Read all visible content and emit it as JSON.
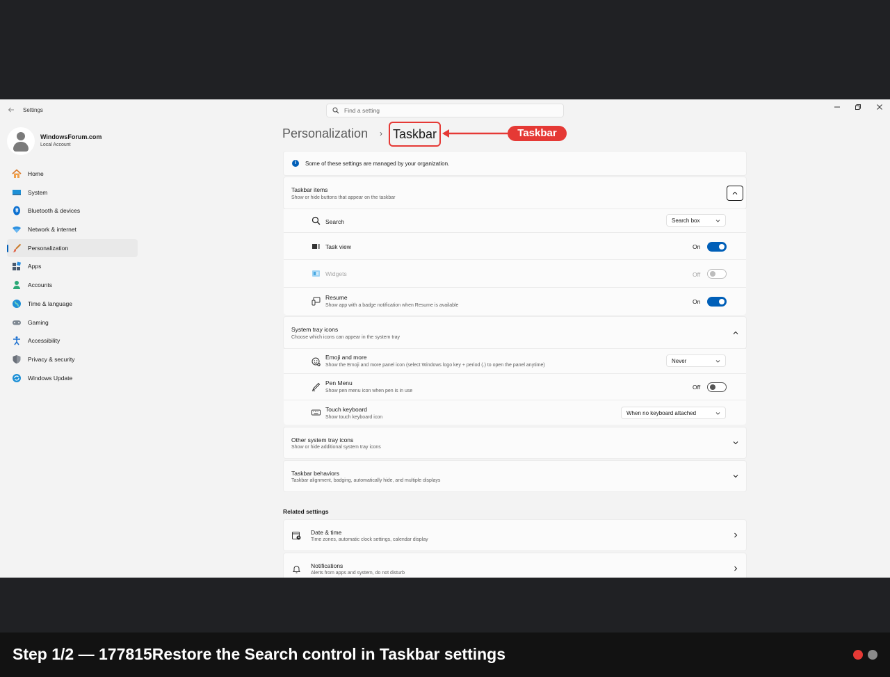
{
  "window": {
    "app_title": "Settings",
    "search_placeholder": "Find a setting"
  },
  "profile": {
    "name": "WindowsForum.com",
    "account_type": "Local Account"
  },
  "sidebar": {
    "items": [
      {
        "label": "Home",
        "icon": "home-icon",
        "selected": false
      },
      {
        "label": "System",
        "icon": "system-icon",
        "selected": false
      },
      {
        "label": "Bluetooth & devices",
        "icon": "bluetooth-icon",
        "selected": false
      },
      {
        "label": "Network & internet",
        "icon": "wifi-icon",
        "selected": false
      },
      {
        "label": "Personalization",
        "icon": "brush-icon",
        "selected": true
      },
      {
        "label": "Apps",
        "icon": "apps-icon",
        "selected": false
      },
      {
        "label": "Accounts",
        "icon": "accounts-icon",
        "selected": false
      },
      {
        "label": "Time & language",
        "icon": "globe-icon",
        "selected": false
      },
      {
        "label": "Gaming",
        "icon": "gamepad-icon",
        "selected": false
      },
      {
        "label": "Accessibility",
        "icon": "accessibility-icon",
        "selected": false
      },
      {
        "label": "Privacy & security",
        "icon": "shield-icon",
        "selected": false
      },
      {
        "label": "Windows Update",
        "icon": "update-icon",
        "selected": false
      }
    ]
  },
  "breadcrumb": {
    "parent": "Personalization",
    "current": "Taskbar",
    "callout": "Taskbar"
  },
  "info": {
    "text": "Some of these settings are managed by your organization."
  },
  "taskbar_items": {
    "title": "Taskbar items",
    "subtitle": "Show or hide buttons that appear on the taskbar",
    "rows": {
      "search": {
        "title": "Search",
        "value": "Search box"
      },
      "task_view": {
        "title": "Task view",
        "state": "On"
      },
      "widgets": {
        "title": "Widgets",
        "state": "Off"
      },
      "resume": {
        "title": "Resume",
        "subtitle": "Show app with a badge notification when Resume is available",
        "state": "On"
      }
    }
  },
  "system_tray": {
    "title": "System tray icons",
    "subtitle": "Choose which icons can appear in the system tray",
    "rows": {
      "emoji": {
        "title": "Emoji and more",
        "subtitle": "Show the Emoji and more panel icon (select Windows logo key + period (.) to open the panel anytime)",
        "value": "Never"
      },
      "pen": {
        "title": "Pen Menu",
        "subtitle": "Show pen menu icon when pen is in use",
        "state": "Off"
      },
      "touch": {
        "title": "Touch keyboard",
        "subtitle": "Show touch keyboard icon",
        "value": "When no keyboard attached"
      }
    }
  },
  "other_tray": {
    "title": "Other system tray icons",
    "subtitle": "Show or hide additional system tray icons"
  },
  "behaviors": {
    "title": "Taskbar behaviors",
    "subtitle": "Taskbar alignment, badging, automatically hide, and multiple displays"
  },
  "related": {
    "label": "Related settings",
    "date_time": {
      "title": "Date & time",
      "subtitle": "Time zones, automatic clock settings, calendar display"
    },
    "notifications": {
      "title": "Notifications",
      "subtitle": "Alerts from apps and system, do not disturb"
    }
  },
  "caption": {
    "text": "Step 1/2 — 177815Restore the Search control in Taskbar settings",
    "dot_colors": [
      "#e53935",
      "#8a8a8a"
    ]
  },
  "colors": {
    "accent": "#005fb8",
    "annotation": "#e53935"
  }
}
